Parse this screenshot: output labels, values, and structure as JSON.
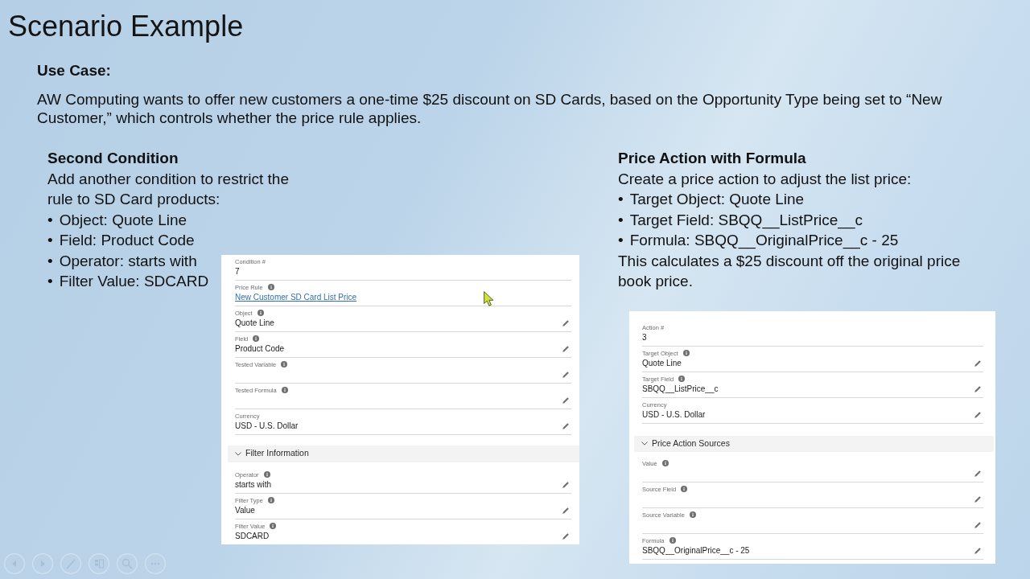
{
  "title": "Scenario Example",
  "use_case": {
    "heading": "Use Case:",
    "text": "AW Computing wants to offer new customers a one-time $25 discount on SD Cards, based on the Opportunity Type being set to “New Customer,” which controls whether the price rule applies."
  },
  "columns": [
    {
      "heading": "Second Condition",
      "intro": "Add another condition to restrict the rule to SD Card products:",
      "bullets": [
        {
          "marker": "•",
          "text": "Object: Quote Line"
        },
        {
          "marker": "•",
          "text": "Field: Product Code"
        },
        {
          "marker": "•",
          "text": "Operator: starts with"
        },
        {
          "marker": "•",
          "text": "Filter Value: SDCARD"
        }
      ],
      "record": {
        "fields": [
          {
            "label": "Condition #",
            "value": "7",
            "kind": "text",
            "info": false,
            "editable": false
          },
          {
            "label": "Price Rule",
            "value": "New Customer SD Card List Price",
            "kind": "link",
            "info": true,
            "editable": false
          },
          {
            "label": "Object",
            "value": "Quote Line",
            "kind": "text",
            "info": true,
            "editable": true
          },
          {
            "label": "Field",
            "value": "Product Code",
            "kind": "text",
            "info": true,
            "editable": true
          },
          {
            "label": "Tested Variable",
            "kind": "text",
            "info": true,
            "editable": true
          },
          {
            "label": "Tested Formula",
            "kind": "text",
            "info": true,
            "editable": true
          },
          {
            "label": "Currency",
            "value": "USD - U.S. Dollar",
            "kind": "text",
            "info": false,
            "editable": true
          }
        ],
        "section": {
          "title": "Filter Information",
          "expanded": true,
          "fields": [
            {
              "label": "Operator",
              "value": "starts with",
              "kind": "text",
              "info": true,
              "editable": true
            },
            {
              "label": "Filter Type",
              "value": "Value",
              "kind": "text",
              "info": true,
              "editable": true
            },
            {
              "label": "Filter Value",
              "value": "SDCARD",
              "kind": "text",
              "info": true,
              "editable": true
            }
          ]
        }
      }
    },
    {
      "heading": "Price Action with Formula",
      "intro": "Create a price action to adjust the list price:",
      "bullets": [
        {
          "marker": "•",
          "text": "Target Object: Quote Line"
        },
        {
          "marker": "•",
          "text": "Target Field: SBQQ__ListPrice__c"
        },
        {
          "marker": "•",
          "text": "Formula: SBQQ__OriginalPrice__c - 25"
        }
      ],
      "note": "This calculates a $25 discount off the original price book price.",
      "record": {
        "fields": [
          {
            "label": "Action #",
            "value": "3",
            "kind": "text",
            "info": false,
            "editable": false
          },
          {
            "label": "Target Object",
            "value": "Quote Line",
            "kind": "text",
            "info": true,
            "editable": true
          },
          {
            "label": "Target Field",
            "value": "SBQQ__ListPrice__c",
            "kind": "text",
            "info": true,
            "editable": true
          },
          {
            "label": "Currency",
            "value": "USD - U.S. Dollar",
            "kind": "text",
            "info": false,
            "editable": true
          }
        ],
        "section": {
          "title": "Price Action Sources",
          "expanded": true,
          "fields": [
            {
              "label": "Value",
              "kind": "text",
              "info": true,
              "editable": true
            },
            {
              "label": "Source Field",
              "kind": "text",
              "info": true,
              "editable": true
            },
            {
              "label": "Source Variable",
              "kind": "text",
              "info": true,
              "editable": true
            },
            {
              "label": "Formula",
              "value": "SBQQ__OriginalPrice__c - 25",
              "kind": "text",
              "info": true,
              "editable": true
            }
          ]
        }
      }
    }
  ]
}
